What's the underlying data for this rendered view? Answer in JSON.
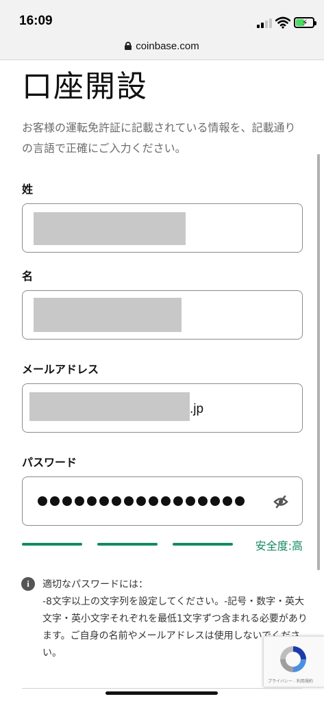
{
  "status_bar": {
    "time": "16:09"
  },
  "browser": {
    "url": "coinbase.com"
  },
  "page": {
    "title": "口座開設",
    "description": "お客様の運転免許証に記載されている情報を、記載通りの言語で正確にご入力ください。"
  },
  "form": {
    "last_name": {
      "label": "姓"
    },
    "first_name": {
      "label": "名"
    },
    "email": {
      "label": "メールアドレス",
      "visible_suffix": ".jp"
    },
    "password": {
      "label": "パスワード",
      "masked_length": 17
    },
    "strength": {
      "label": "安全度:高",
      "level": 3,
      "max": 3
    }
  },
  "password_hint": {
    "title": "適切なパスワードには：",
    "body": "-8文字以上の文字列を設定してください。-記号・数字・英大文字・英小文字それぞれを最低1文字ずつ含まれる必要があります。ご自身の名前やメールアドレスは使用しないでください。"
  },
  "recaptcha": {
    "links": "プライバシー - 利用規約"
  },
  "colors": {
    "accent": "#138a60",
    "redaction": "#c8c8c8"
  },
  "icons": [
    "lock-icon",
    "signal-icon",
    "wifi-icon",
    "battery-icon",
    "eye-off-icon",
    "info-icon",
    "recaptcha-icon"
  ]
}
